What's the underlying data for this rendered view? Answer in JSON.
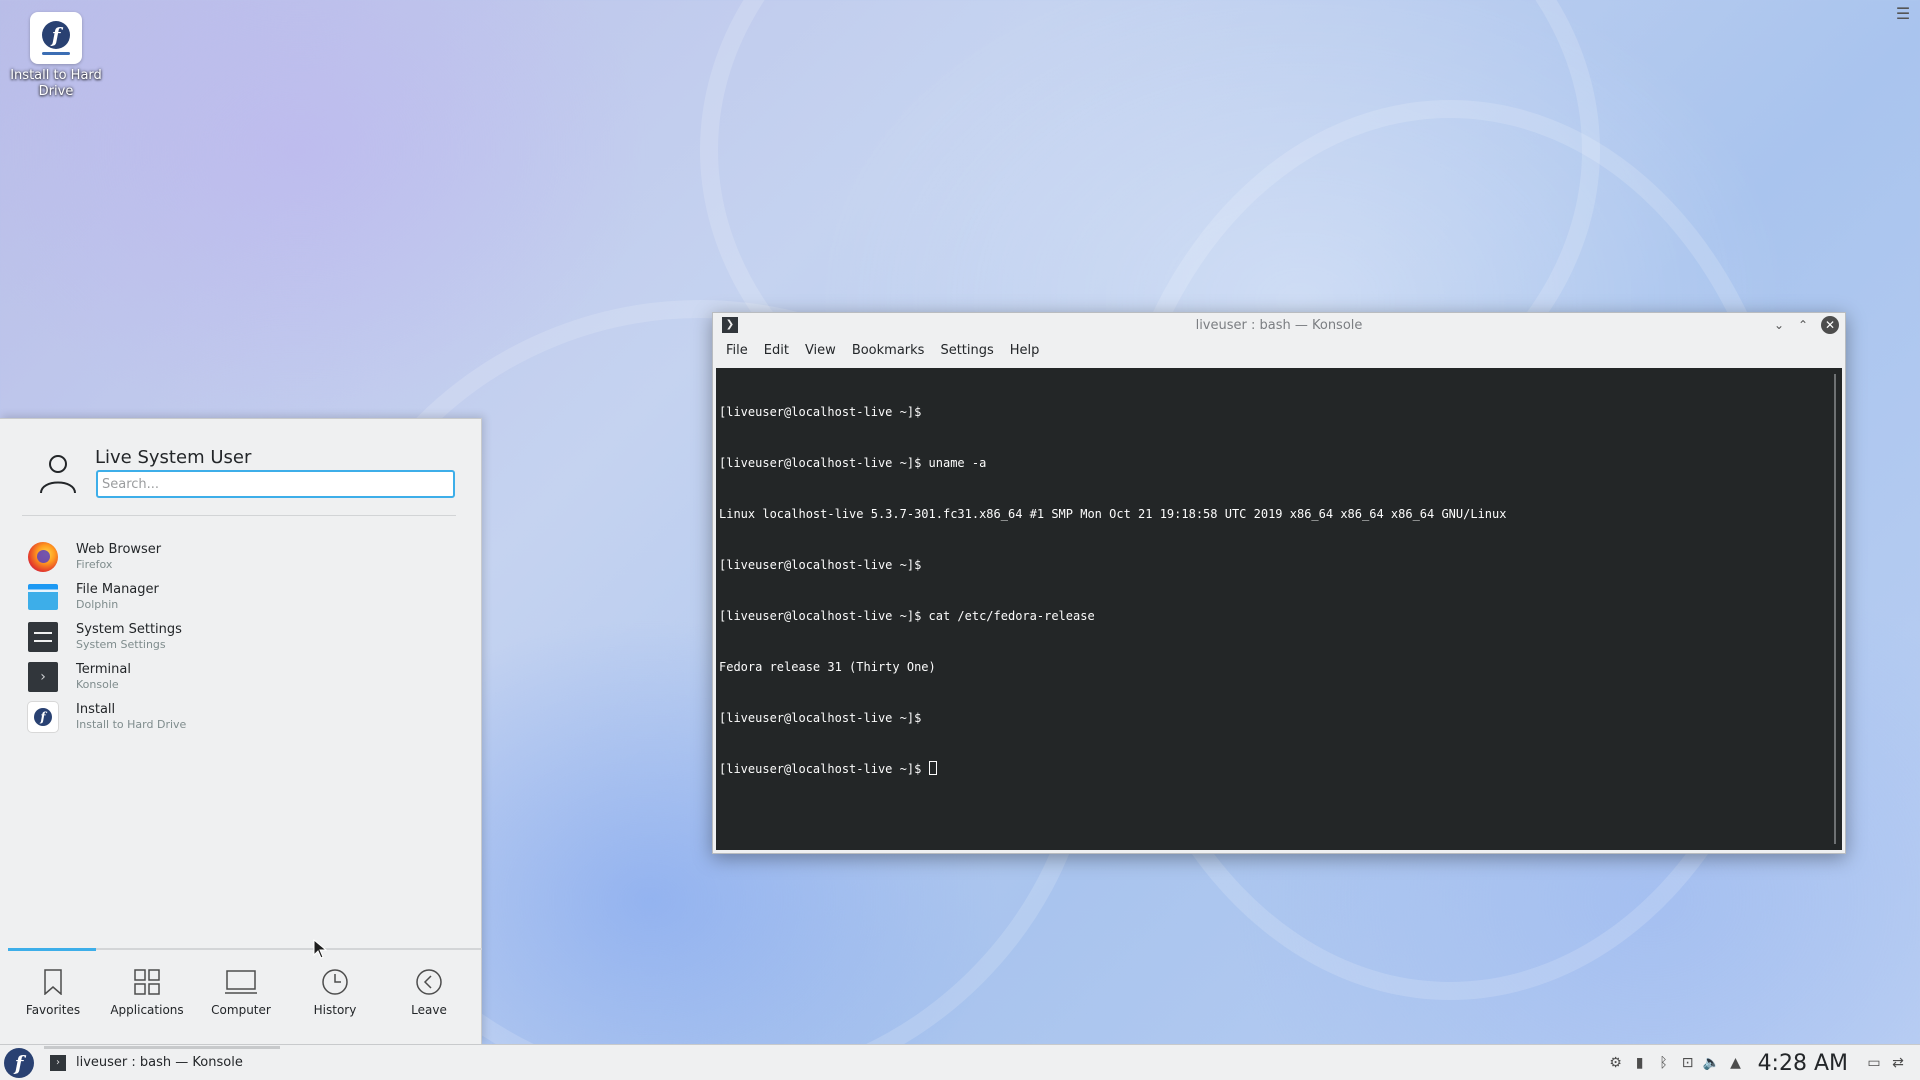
{
  "desktop": {
    "icon_label": "Install to Hard Drive"
  },
  "konsole": {
    "title": "liveuser : bash — Konsole",
    "menu": [
      "File",
      "Edit",
      "View",
      "Bookmarks",
      "Settings",
      "Help"
    ],
    "lines": [
      "[liveuser@localhost-live ~]$",
      "[liveuser@localhost-live ~]$ uname -a",
      "Linux localhost-live 5.3.7-301.fc31.x86_64 #1 SMP Mon Oct 21 19:18:58 UTC 2019 x86_64 x86_64 x86_64 GNU/Linux",
      "[liveuser@localhost-live ~]$",
      "[liveuser@localhost-live ~]$ cat /etc/fedora-release",
      "Fedora release 31 (Thirty One)",
      "[liveuser@localhost-live ~]$",
      "[liveuser@localhost-live ~]$ "
    ]
  },
  "launcher": {
    "user_name": "Live System User",
    "search_placeholder": "Search...",
    "favorites": [
      {
        "name": "Web Browser",
        "sub": "Firefox",
        "icon": "firefox-icon"
      },
      {
        "name": "File Manager",
        "sub": "Dolphin",
        "icon": "folder-icon"
      },
      {
        "name": "System Settings",
        "sub": "System Settings",
        "icon": "settings-icon"
      },
      {
        "name": "Terminal",
        "sub": "Konsole",
        "icon": "terminal-icon"
      },
      {
        "name": "Install",
        "sub": "Install to Hard Drive",
        "icon": "fedora-install-icon"
      }
    ],
    "tabs": [
      "Favorites",
      "Applications",
      "Computer",
      "History",
      "Leave"
    ]
  },
  "taskbar": {
    "task_title": "liveuser : bash — Konsole",
    "clock": "4:28 AM"
  }
}
